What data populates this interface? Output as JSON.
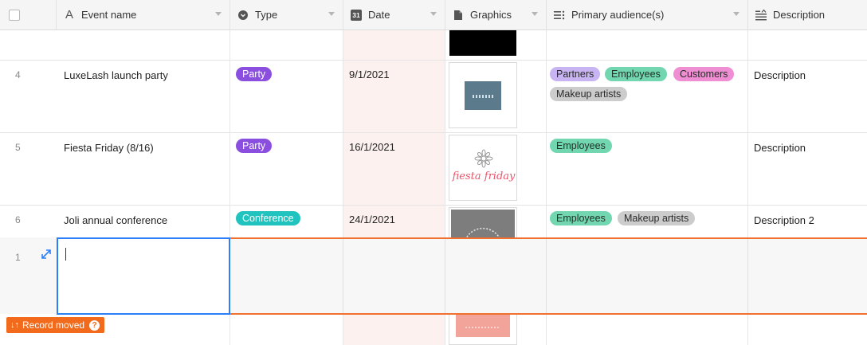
{
  "columns": {
    "event_name": "Event name",
    "type": "Type",
    "date": "Date",
    "date_icon_text": "31",
    "graphics": "Graphics",
    "audience": "Primary audience(s)",
    "description": "Description"
  },
  "rows": [
    {
      "num": "4",
      "name": "LuxeLash launch party",
      "type": "Party",
      "date": "9/1/2021",
      "audience": [
        "Partners",
        "Employees",
        "Customers",
        "Makeup artists"
      ],
      "description": "Description"
    },
    {
      "num": "5",
      "name": "Fiesta Friday (8/16)",
      "type": "Party",
      "date": "16/1/2021",
      "graphic_text": "fiesta friday",
      "audience": [
        "Employees"
      ],
      "description": "Description"
    },
    {
      "num": "6",
      "name": "Joli annual conference",
      "type": "Conference",
      "date": "24/1/2021",
      "audience": [
        "Employees",
        "Makeup artists"
      ],
      "description": "Description 2"
    }
  ],
  "new_row": {
    "num": "1"
  },
  "toast": {
    "label": "Record moved"
  },
  "colors": {
    "party": "#8b4fe0",
    "conference": "#21c3be",
    "partners": "#c8b4f2",
    "employees": "#72d6b0",
    "customers": "#f08ed3",
    "makeup_artists": "#cccccc",
    "selection": "#2d7ff9",
    "moved_indicator": "#f26a1b"
  }
}
